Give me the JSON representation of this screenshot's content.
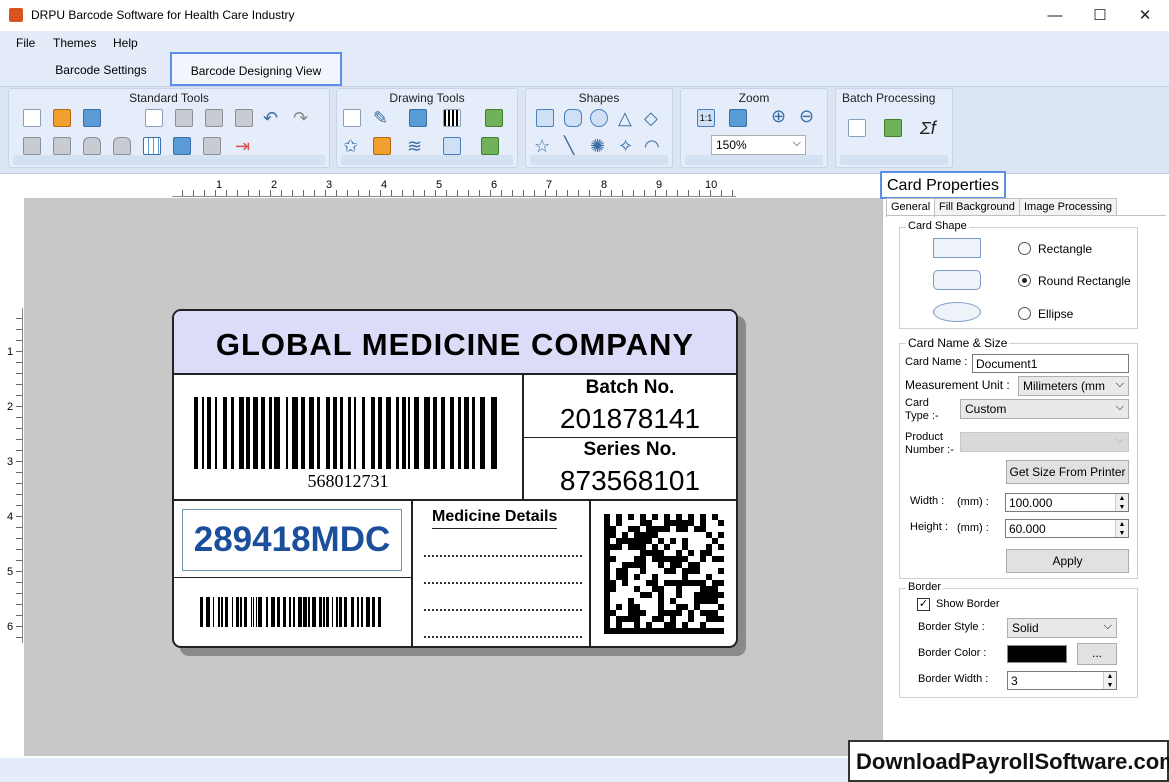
{
  "window": {
    "title": "DRPU Barcode Software for Health Care Industry",
    "minimize": "—",
    "maximize": "☐",
    "close": "✕"
  },
  "menu": {
    "items": [
      "File",
      "Themes",
      "Help"
    ]
  },
  "tabs": {
    "barcode_settings": "Barcode Settings",
    "barcode_designing": "Barcode Designing View"
  },
  "ribbon": {
    "groups": [
      "Standard Tools",
      "Drawing Tools",
      "Shapes",
      "Zoom",
      "Batch Processing"
    ],
    "zoom_value": "150%"
  },
  "rulers": {
    "h": [
      "1",
      "2",
      "3",
      "4",
      "5",
      "6",
      "7",
      "8",
      "9",
      "10"
    ],
    "v": [
      "1",
      "2",
      "3",
      "4",
      "5",
      "6"
    ]
  },
  "card": {
    "company": "GLOBAL MEDICINE COMPANY",
    "barcode_number": "568012731",
    "batch_label": "Batch No.",
    "batch_value": "201878141",
    "series_label": "Series No.",
    "series_value": "873568101",
    "rx_code": "289418MDC",
    "medicine_details": "Medicine Details"
  },
  "props": {
    "title": "Card Properties",
    "tabs": [
      "General",
      "Fill Background",
      "Image Processing"
    ],
    "card_shape": {
      "legend": "Card Shape",
      "options": [
        "Rectangle",
        "Round Rectangle",
        "Ellipse"
      ],
      "selected": "Round Rectangle"
    },
    "name_size": {
      "legend": "Card  Name & Size",
      "card_name_label": "Card Name :",
      "card_name_value": "Document1",
      "unit_label": "Measurement Unit :",
      "unit_value": "Milimeters (mm",
      "type_label_1": "Card",
      "type_label_2": "Type :-",
      "type_value": "Custom",
      "product_label_1": "Product",
      "product_label_2": "Number :-",
      "get_size_button": "Get Size From Printer",
      "width_label": "Width :",
      "height_label": "Height :",
      "mm_label": "(mm) :",
      "width_value": "100.000",
      "height_value": "60.000",
      "apply_button": "Apply"
    },
    "border": {
      "legend": "Border",
      "show_border": "Show Border",
      "show_border_checked": true,
      "style_label": "Border Style :",
      "style_value": "Solid",
      "color_label": "Border Color :",
      "color_value": "#000000",
      "color_button": "...",
      "width_label": "Border Width :",
      "width_value": "3"
    }
  },
  "watermark": "DownloadPayrollSoftware.com"
}
